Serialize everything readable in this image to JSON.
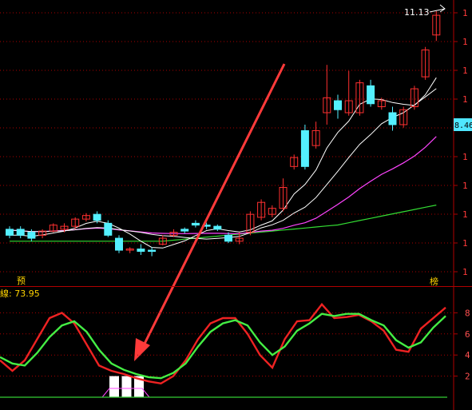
{
  "chart_data": [
    {
      "type": "candlestick",
      "price_high_label": "11.13",
      "price_tag_label": "8.46",
      "axis_ticks": [
        "1",
        "1",
        "1",
        "1",
        "1",
        "1",
        "1",
        "1",
        "1",
        "1"
      ],
      "left_marker": "预",
      "right_marker": "榜",
      "colors": {
        "up": "#ff3030",
        "down": "#54f0ff",
        "ma_short": "#ffffff",
        "ma_mid": "#ff44ff",
        "ma_long": "#33dd33",
        "ma_flat": "#ffffff"
      },
      "candles": [
        {
          "o": 7.55,
          "c": 7.45,
          "h": 7.6,
          "l": 7.4
        },
        {
          "o": 7.55,
          "c": 7.45,
          "h": 7.6,
          "l": 7.4
        },
        {
          "o": 7.5,
          "c": 7.4,
          "h": 7.55,
          "l": 7.35
        },
        {
          "o": 7.45,
          "c": 7.52,
          "h": 7.55,
          "l": 7.4
        },
        {
          "o": 7.52,
          "c": 7.62,
          "h": 7.65,
          "l": 7.5
        },
        {
          "o": 7.55,
          "c": 7.6,
          "h": 7.65,
          "l": 7.5
        },
        {
          "o": 7.6,
          "c": 7.72,
          "h": 7.75,
          "l": 7.55
        },
        {
          "o": 7.72,
          "c": 7.78,
          "h": 7.82,
          "l": 7.68
        },
        {
          "o": 7.8,
          "c": 7.7,
          "h": 7.85,
          "l": 7.65
        },
        {
          "o": 7.65,
          "c": 7.45,
          "h": 7.7,
          "l": 7.42
        },
        {
          "o": 7.4,
          "c": 7.2,
          "h": 7.45,
          "l": 7.15
        },
        {
          "o": 7.2,
          "c": 7.22,
          "h": 7.25,
          "l": 7.15
        },
        {
          "o": 7.22,
          "c": 7.18,
          "h": 7.3,
          "l": 7.12
        },
        {
          "o": 7.2,
          "c": 7.18,
          "h": 7.25,
          "l": 7.1
        },
        {
          "o": 7.3,
          "c": 7.4,
          "h": 7.45,
          "l": 7.28
        },
        {
          "o": 7.45,
          "c": 7.5,
          "h": 7.55,
          "l": 7.42
        },
        {
          "o": 7.55,
          "c": 7.52,
          "h": 7.58,
          "l": 7.48
        },
        {
          "o": 7.65,
          "c": 7.62,
          "h": 7.7,
          "l": 7.58
        },
        {
          "o": 7.62,
          "c": 7.6,
          "h": 7.66,
          "l": 7.55
        },
        {
          "o": 7.6,
          "c": 7.55,
          "h": 7.63,
          "l": 7.52
        },
        {
          "o": 7.45,
          "c": 7.35,
          "h": 7.5,
          "l": 7.32
        },
        {
          "o": 7.35,
          "c": 7.4,
          "h": 7.5,
          "l": 7.3
        },
        {
          "o": 7.5,
          "c": 7.8,
          "h": 7.85,
          "l": 7.45
        },
        {
          "o": 7.75,
          "c": 8.0,
          "h": 8.05,
          "l": 7.7
        },
        {
          "o": 7.8,
          "c": 7.9,
          "h": 7.95,
          "l": 7.75
        },
        {
          "o": 7.9,
          "c": 8.25,
          "h": 8.4,
          "l": 7.85
        },
        {
          "o": 8.6,
          "c": 8.75,
          "h": 8.8,
          "l": 8.55
        },
        {
          "o": 9.2,
          "c": 8.6,
          "h": 9.3,
          "l": 8.55
        },
        {
          "o": 8.95,
          "c": 9.2,
          "h": 9.35,
          "l": 8.9
        },
        {
          "o": 9.5,
          "c": 9.75,
          "h": 10.3,
          "l": 9.3
        },
        {
          "o": 9.7,
          "c": 9.55,
          "h": 9.8,
          "l": 9.4
        },
        {
          "o": 9.5,
          "c": 9.7,
          "h": 10.2,
          "l": 9.45
        },
        {
          "o": 9.5,
          "c": 10.0,
          "h": 10.05,
          "l": 9.45
        },
        {
          "o": 9.95,
          "c": 9.65,
          "h": 10.05,
          "l": 9.6
        },
        {
          "o": 9.6,
          "c": 9.7,
          "h": 9.75,
          "l": 9.55
        },
        {
          "o": 9.5,
          "c": 9.3,
          "h": 9.6,
          "l": 9.2
        },
        {
          "o": 9.3,
          "c": 9.55,
          "h": 9.6,
          "l": 9.25
        },
        {
          "o": 9.6,
          "c": 9.9,
          "h": 9.95,
          "l": 9.55
        },
        {
          "o": 10.1,
          "c": 10.55,
          "h": 10.6,
          "l": 10.05
        },
        {
          "o": 10.8,
          "c": 11.13,
          "h": 11.2,
          "l": 10.7
        }
      ]
    },
    {
      "type": "line",
      "title": "線: 73.95",
      "y_ticks": [
        "8",
        "6",
        "4",
        "2"
      ],
      "ylim": [
        0,
        10
      ],
      "series": [
        {
          "values": [
            3.5,
            2.5,
            3.5,
            5.5,
            7.5,
            8,
            7,
            5,
            3,
            2.5,
            2.2,
            1.8,
            1.5,
            1.3,
            2.0,
            3.5,
            5.5,
            7.0,
            7.5,
            7.5,
            6.0,
            4.0,
            2.8,
            5.5,
            7.2,
            7.3,
            8.8,
            7.5,
            7.6,
            7.8,
            7.2,
            6.3,
            4.5,
            4.3,
            6.5,
            7.5,
            8.5
          ]
        },
        {
          "values": [
            3.8,
            3.2,
            3.0,
            4.2,
            5.7,
            6.8,
            7.2,
            6.2,
            4.5,
            3.2,
            2.6,
            2.2,
            1.9,
            1.8,
            2.3,
            3.2,
            4.8,
            6.2,
            7.0,
            7.3,
            6.8,
            5.2,
            4.0,
            4.8,
            6.3,
            7.0,
            7.9,
            7.7,
            7.9,
            7.9,
            7.3,
            6.8,
            5.4,
            4.7,
            5.2,
            6.6,
            7.7
          ]
        }
      ],
      "signal_bars": [
        0,
        0,
        0,
        0,
        0,
        0,
        0,
        0,
        0,
        0,
        0,
        2.0,
        2.0,
        2.0,
        0,
        0,
        0,
        0,
        0,
        0,
        0,
        0,
        0,
        0,
        0,
        0,
        0,
        0,
        0,
        0,
        0,
        0,
        0,
        0,
        0,
        0,
        0
      ]
    }
  ]
}
